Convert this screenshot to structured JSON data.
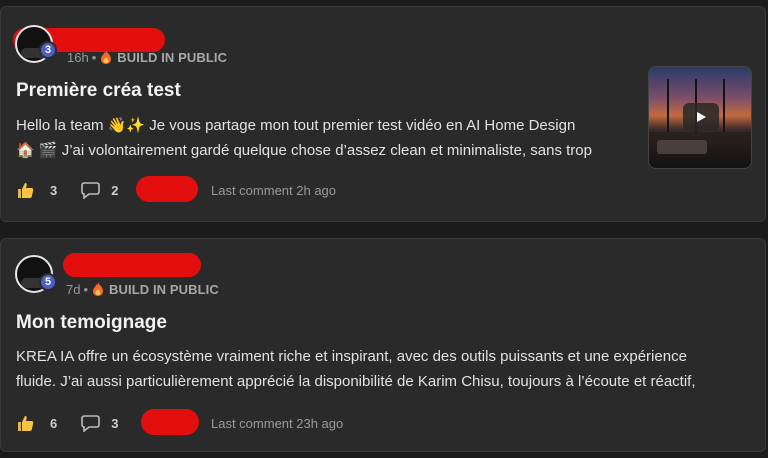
{
  "posts": [
    {
      "level": "3",
      "time": "16h",
      "category_icon": "fire-icon",
      "category": "BUILD IN PUBLIC",
      "title": "Première créa test",
      "body_lines": [
        "Hello la team  👋✨  Je vous partage mon tout premier test vidéo en AI Home Design",
        "🏠 🎬 J’ai volontairement gardé quelque chose d’assez clean et minimaliste, sans trop"
      ],
      "has_video_thumbnail": true,
      "likes": "3",
      "comments": "2",
      "last_comment": "Last comment 2h ago"
    },
    {
      "level": "5",
      "time": "7d",
      "category_icon": "fire-icon",
      "category": "BUILD IN PUBLIC",
      "title": "Mon temoignage",
      "body_lines": [
        "KREA IA offre un écosystème vraiment riche et inspirant, avec des outils puissants et une expérience",
        "fluide. J’ai aussi particulièrement apprécié la disponibilité de Karim Chisu, toujours à l’écoute et réactif,"
      ],
      "has_video_thumbnail": false,
      "likes": "6",
      "comments": "3",
      "last_comment": "Last comment 23h ago"
    }
  ],
  "colors": {
    "background": "#1b1b1b",
    "card": "#2a2a2a",
    "level_badge": "#4b5fc4",
    "redaction": "#e30f0f"
  }
}
